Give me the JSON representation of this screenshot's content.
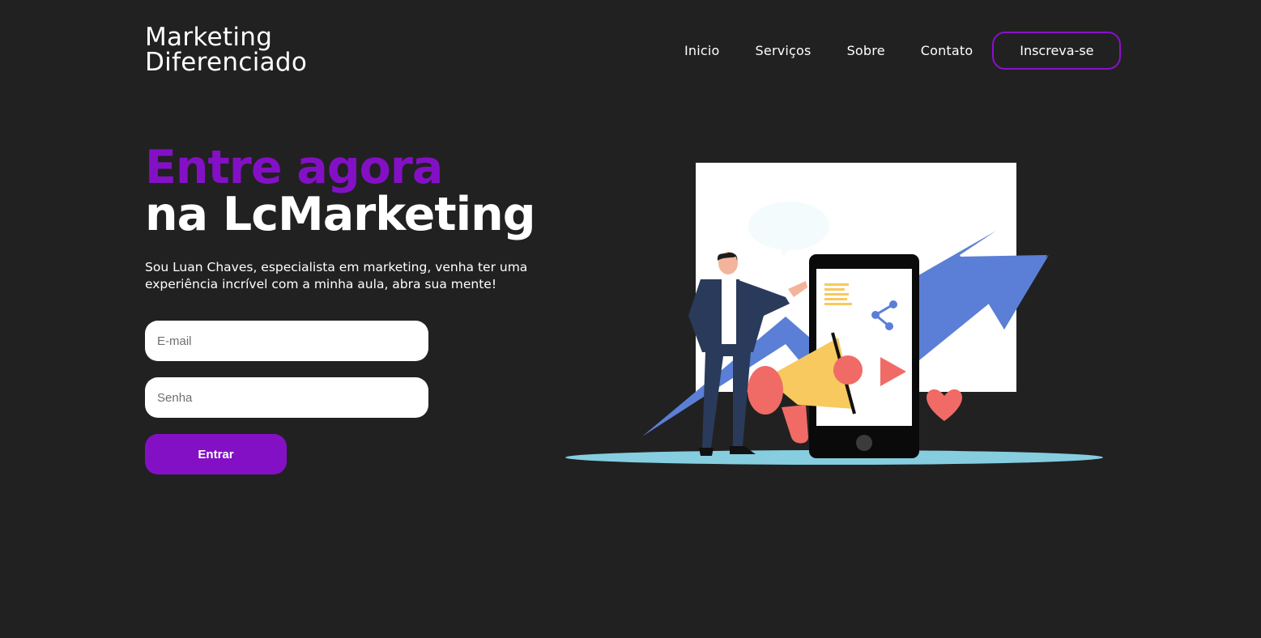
{
  "header": {
    "logo_line1": "Marketing",
    "logo_line2": "Diferenciado",
    "nav": {
      "inicio": "Inicio",
      "servicos": "Serviços",
      "sobre": "Sobre",
      "contato": "Contato"
    },
    "signup_label": "Inscreva-se"
  },
  "hero": {
    "title_accent": "Entre agora",
    "title_main": "na LcMarketing",
    "subtitle": "Sou Luan Chaves, especialista em marketing, venha ter uma experiência incrível com a minha aula, abra sua mente!",
    "email_placeholder": "E-mail",
    "password_placeholder": "Senha",
    "submit_label": "Entrar"
  },
  "illustration": {
    "icon": "marketing-illustration-icon"
  },
  "colors": {
    "background": "#212121",
    "accent": "#8410c6",
    "arrow": "#5b7fd6",
    "megaphone_yellow": "#f7c95e",
    "coral": "#f06b66"
  }
}
